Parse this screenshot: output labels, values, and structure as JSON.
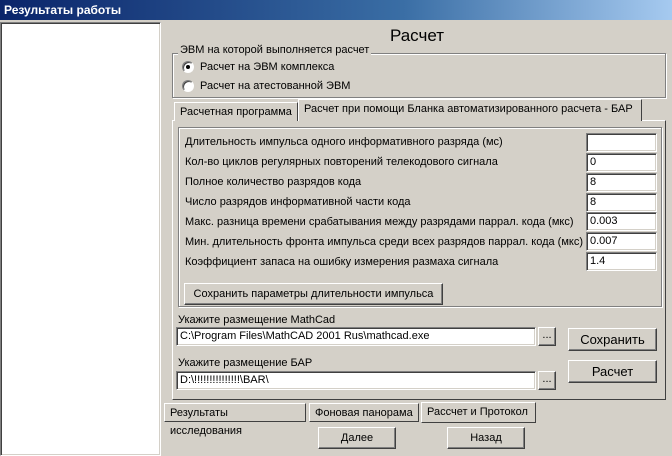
{
  "window": {
    "title": "Результаты работы"
  },
  "heading": "Расчет",
  "computer_group": {
    "legend": "ЭВМ на которой выполняется расчет",
    "options": [
      {
        "label": "Расчет на ЭВМ комплекса",
        "checked": true
      },
      {
        "label": "Расчет на атестованной ЭВМ",
        "checked": false
      }
    ]
  },
  "tabs": [
    {
      "label": "Расчетная программа",
      "active": false
    },
    {
      "label": "Расчет при помощи Бланка автоматизированного расчета - БАР",
      "active": true
    }
  ],
  "params": [
    {
      "label": "Длительность импульса одного информативного разряда (мс)",
      "value": ""
    },
    {
      "label": "Кол-во циклов регулярных повторений телекодового сигнала",
      "value": "0"
    },
    {
      "label": "Полное количество разрядов кода",
      "value": "8"
    },
    {
      "label": "Число разрядов информативной части кода",
      "value": "8"
    },
    {
      "label": "Макс. разница времени срабатывания между разрядами паррал. кода (мкс)",
      "value": "0.003"
    },
    {
      "label": "Мин. длительность фронта импульса среди всех разрядов паррал. кода (мкс)",
      "value": "0.007"
    },
    {
      "label": "Коэффициент запаса на ошибку измерения размаха сигнала",
      "value": "1.4"
    }
  ],
  "save_params_button": "Сохранить параметры длительности импульса",
  "mathcad": {
    "label": "Укажите размещение MathCad",
    "value": "C:\\Program Files\\MathCAD 2001 Rus\\mathcad.exe",
    "browse": "..."
  },
  "bar": {
    "label": "Укажите размещение БАР",
    "value": "D:\\!!!!!!!!!!!!!!!\\BAR\\",
    "browse": "..."
  },
  "save_button": "Сохранить",
  "calc_button": "Расчет",
  "bottom_tabs": [
    {
      "label": "Результаты исследования",
      "active": false
    },
    {
      "label": "Фоновая панорама",
      "active": false
    },
    {
      "label": "Рассчет и Протокол",
      "active": true
    }
  ],
  "next_button": "Далее",
  "back_button": "Назад"
}
